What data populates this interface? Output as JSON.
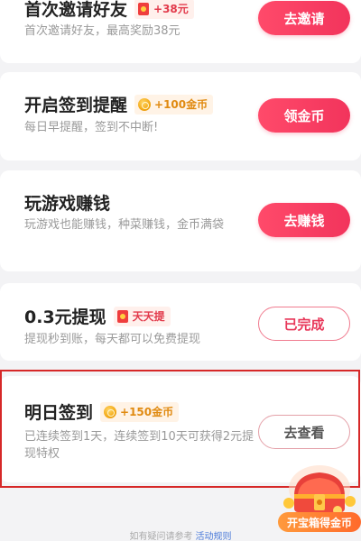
{
  "tasks": [
    {
      "title": "首次邀请好友",
      "badge": "+38元",
      "description": "首次邀请好友，最高奖励38元",
      "button": "去邀请"
    },
    {
      "title": "开启签到提醒",
      "badge": "+100金币",
      "description": "每日早提醒，签到不中断!",
      "button": "领金币"
    },
    {
      "title": "玩游戏赚钱",
      "description": "玩游戏也能赚钱，种菜赚钱，金币满袋",
      "button": "去赚钱"
    },
    {
      "title": "0.3元提现",
      "badge": "天天提",
      "description": "提现秒到账，每天都可以免费提现",
      "button": "已完成"
    },
    {
      "title": "明日签到",
      "badge": "+150金币",
      "description": "已连续签到1天，连续签到10天可获得2元提现特权",
      "button": "去查看"
    }
  ],
  "treasure": {
    "label": "开宝箱得金币"
  },
  "footer": {
    "text": "如有疑问请参考",
    "link": "活动规则"
  },
  "colors": {
    "accent": "#f2345c",
    "coin": "#e08a10",
    "highlight": "#d62828",
    "link": "#4c7bd9"
  }
}
